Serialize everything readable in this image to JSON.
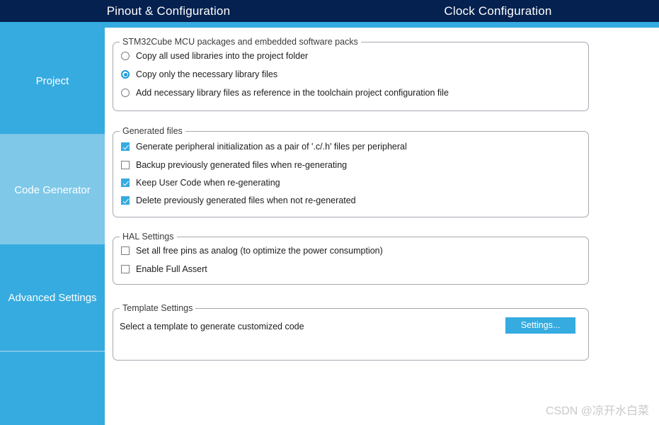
{
  "tabs": [
    {
      "label": "Pinout & Configuration"
    },
    {
      "label": "Clock Configuration"
    }
  ],
  "sidebar": {
    "items": [
      {
        "label": "Project",
        "active": false
      },
      {
        "label": "Code Generator",
        "active": true
      },
      {
        "label": "Advanced Settings",
        "active": false
      },
      {
        "label": "",
        "active": false
      }
    ]
  },
  "groups": {
    "packages": {
      "title": "STM32Cube MCU packages and embedded software packs",
      "options": [
        {
          "label": "Copy all used libraries into the project folder",
          "checked": false
        },
        {
          "label": "Copy only the necessary library files",
          "checked": true
        },
        {
          "label": "Add necessary library files as reference in the toolchain project configuration file",
          "checked": false
        }
      ]
    },
    "generated_files": {
      "title": "Generated files",
      "options": [
        {
          "label": "Generate peripheral initialization as a pair of '.c/.h' files per peripheral",
          "checked": true
        },
        {
          "label": "Backup previously generated files when re-generating",
          "checked": false
        },
        {
          "label": "Keep User Code when re-generating",
          "checked": true
        },
        {
          "label": "Delete previously generated files when not re-generated",
          "checked": true
        }
      ]
    },
    "hal_settings": {
      "title": "HAL Settings",
      "options": [
        {
          "label": "Set all free pins as analog (to optimize the power consumption)",
          "checked": false
        },
        {
          "label": "Enable Full Assert",
          "checked": false
        }
      ]
    },
    "template_settings": {
      "title": "Template Settings",
      "description": "Select a template to generate customized code",
      "settings_button": "Settings..."
    }
  },
  "watermark": "CSDN @凉开水白菜",
  "colors": {
    "header_navy": "#05214f",
    "accent_blue": "#35abe0",
    "active_sidebar": "#7fc8e8",
    "group_border": "#a3a9b0"
  }
}
